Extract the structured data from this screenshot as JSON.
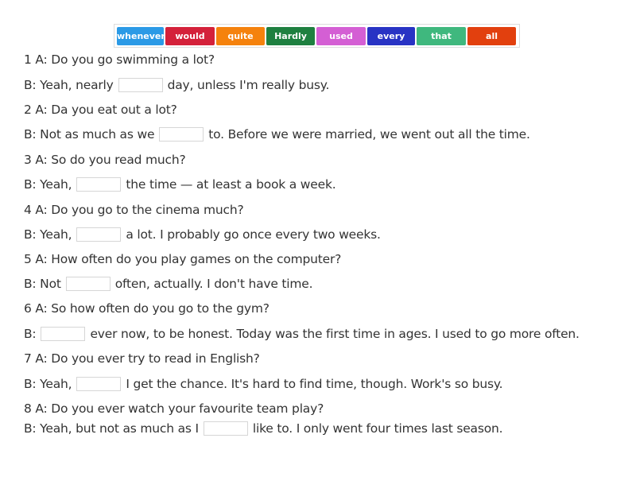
{
  "word_bank": [
    {
      "word": "whenever",
      "color": "#2b9ae6"
    },
    {
      "word": "would",
      "color": "#d4213a"
    },
    {
      "word": "quite",
      "color": "#f5820d"
    },
    {
      "word": "Hardly",
      "color": "#1e8040"
    },
    {
      "word": "used",
      "color": "#d45fd4"
    },
    {
      "word": "every",
      "color": "#2833c4"
    },
    {
      "word": "that",
      "color": "#3fb87e"
    },
    {
      "word": "all",
      "color": "#e2400e"
    }
  ],
  "lines": [
    {
      "before": "1 A: Do you go swimming a lot?"
    },
    {
      "before": "B: Yeah, nearly",
      "after": "day, unless I'm really busy."
    },
    {
      "before": "2 A: Da you eat out a lot?"
    },
    {
      "before": "B: Not as much as we",
      "after": "to. Before we were married, we went out all the time."
    },
    {
      "before": "3 A: So do you read much?"
    },
    {
      "before": "B: Yeah,",
      "after": "the time — at least a book a week."
    },
    {
      "before": "4 A: Do you go to the cinema much?"
    },
    {
      "before": "B: Yeah,",
      "after": "a lot. I probably go once every two weeks."
    },
    {
      "before": "5 A: How often do you play games on the computer?"
    },
    {
      "before": "B: Not",
      "after": "often, actually. I don't have time."
    },
    {
      "before": "6 A: So how often do you go to the gym?"
    },
    {
      "before": "B:",
      "after": "ever now, to be honest. Today was the first time in ages. I used to go more often."
    },
    {
      "before": "7 A: Do you ever try to read in English?"
    },
    {
      "before": "B: Yeah,",
      "after": "I get the chance. It's hard to find time, though. Work's so busy."
    },
    {
      "before": "8 A: Do you ever watch your favourite team play?"
    },
    {
      "before": "B: Yeah, but not as much as I",
      "after": "like to. I only went four times last season."
    }
  ]
}
